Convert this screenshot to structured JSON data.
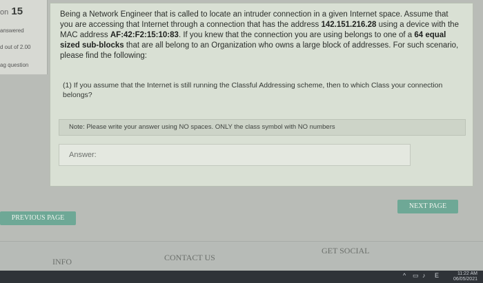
{
  "sidebar": {
    "question_prefix": "on",
    "question_number": "15",
    "status": "answered",
    "marks": "d out of 2.00",
    "flag": "ag question"
  },
  "question": {
    "intro": "Being a Network Engineer that is called to locate an intruder connection in a given Internet space. Assume that you are accessing that Internet through a connection that has the address ",
    "ip_address": "142.151.216.28",
    "mid1": " using a device with the MAC address ",
    "mac_address": "AF:42:F2:15:10:83",
    "mid2": ". If you knew that the connection you are using belongs to one of a ",
    "subblocks": "64 equal sized sub-blocks",
    "tail": " that are all belong to an Organization who owns a large block of addresses. For such scenario, please find the following:",
    "subquestion": "(1) If you assume that the Internet is still running the Classful Addressing scheme, then to which Class your connection belongs?"
  },
  "note": "Note: Please write your answer using NO spaces. ONLY the class symbol with NO numbers",
  "answer": {
    "placeholder": "Answer:"
  },
  "navigation": {
    "previous": "PREVIOUS PAGE",
    "next": "NEXT PAGE"
  },
  "footer": {
    "info": "INFO",
    "contact": "CONTACT US",
    "social": "GET SOCIAL"
  },
  "taskbar": {
    "lang": "E",
    "time": "11:22 AM",
    "date": "06/05/2021"
  }
}
